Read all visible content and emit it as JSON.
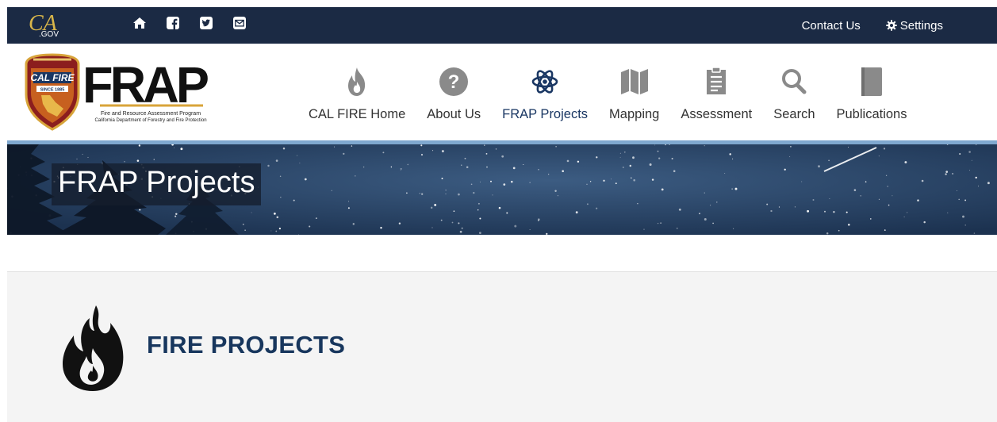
{
  "utility": {
    "logo_text": "CA.GOV",
    "icons": [
      "home-icon",
      "facebook-icon",
      "twitter-icon",
      "email-icon"
    ],
    "contact_label": "Contact Us",
    "settings_label": "Settings"
  },
  "brand": {
    "badge_text": "CAL FIRE",
    "badge_since": "SINCE 1885",
    "wordmark": "FRAP",
    "tagline_line1": "Fire and Resource Assessment Program",
    "tagline_line2": "California Department of Forestry and Fire Protection"
  },
  "nav": {
    "items": [
      {
        "label": "CAL FIRE Home",
        "icon": "flame-icon"
      },
      {
        "label": "About Us",
        "icon": "question-circle-icon"
      },
      {
        "label": "FRAP Projects",
        "icon": "atom-icon",
        "active": true
      },
      {
        "label": "Mapping",
        "icon": "map-icon"
      },
      {
        "label": "Assessment",
        "icon": "clipboard-icon"
      },
      {
        "label": "Search",
        "icon": "search-icon"
      },
      {
        "label": "Publications",
        "icon": "book-icon"
      }
    ]
  },
  "banner": {
    "title": "FRAP Projects"
  },
  "section": {
    "title": "FIRE PROJECTS",
    "icon": "fire-icon"
  },
  "colors": {
    "utility_bg": "#1b2a44",
    "accent_blue": "#17365d",
    "banner_rule": "#7fa8cf",
    "nav_icon_gray": "#8a8a8a",
    "section_bg": "#f4f4f4"
  }
}
